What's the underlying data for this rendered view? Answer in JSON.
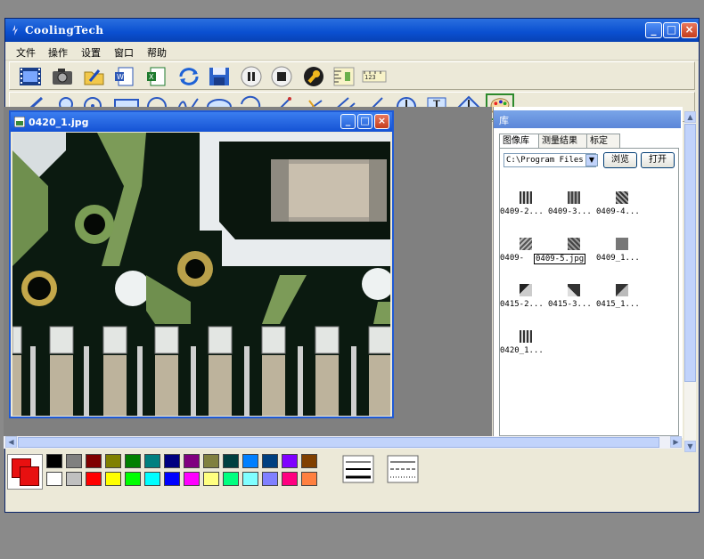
{
  "window": {
    "title": "CoolingTech",
    "minimize": "_",
    "maximize": "□",
    "close": "×"
  },
  "menu": [
    "文件",
    "操作",
    "设置",
    "窗口",
    "帮助"
  ],
  "toolbar1": [
    "film-icon",
    "camera-icon",
    "open-folder-icon",
    "word-export-icon",
    "excel-export-icon",
    "refresh-icon",
    "save-icon",
    "pause-icon",
    "stop-icon",
    "wrench-icon",
    "ruler-icon",
    "scale-ruler-icon"
  ],
  "toolbar2": [
    "line-tool-icon",
    "magnifier-icon",
    "circle-zoom-icon",
    "rectangle-tool-icon",
    "circle-tool-icon",
    "freehand-tool-icon",
    "ellipse-tool-icon",
    "arc-tool-icon",
    "distance-tool-icon",
    "point-line-icon",
    "parallel-lines-icon",
    "angle-tool-icon",
    "circle-diameter-icon",
    "vertical-distance-icon",
    "diamond-height-icon",
    "palette-icon"
  ],
  "image_window": {
    "title": "0420_1.jpg"
  },
  "library": {
    "title": "库",
    "tabs": [
      "图像库",
      "测量结果",
      "标定"
    ],
    "path": "C:\\Program Files",
    "browse": "浏览",
    "open": "打开",
    "thumbnails": [
      "0409-2...",
      "0409-3...",
      "0409-4...",
      "0409-",
      "0409-5.jpg",
      "0409_1...",
      "0415-2...",
      "0415-3...",
      "0415_1...",
      "0420_1..."
    ]
  },
  "palette_colors": [
    "#000000",
    "#808080",
    "#800000",
    "#808000",
    "#008000",
    "#008080",
    "#000080",
    "#800080",
    "#808040",
    "#004040",
    "#0080ff",
    "#004080",
    "#8000ff",
    "#804000",
    "#ffffff",
    "#c0c0c0",
    "#ff0000",
    "#ffff00",
    "#00ff00",
    "#00ffff",
    "#0000ff",
    "#ff00ff",
    "#ffff80",
    "#00ff80",
    "#80ffff",
    "#8080ff",
    "#ff0080",
    "#ff8040"
  ],
  "current_color": "#e81010"
}
